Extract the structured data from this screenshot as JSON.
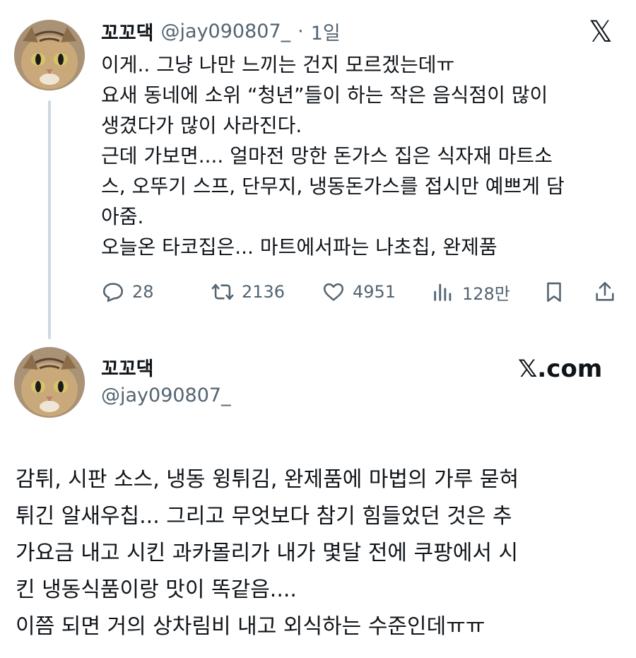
{
  "tweet1": {
    "display_name": "꼬꼬댁",
    "handle": "@jay090807_",
    "separator": "·",
    "time": "1일",
    "x_logo": "𝕏",
    "lines": [
      "이게.. 그냥 나만 느끼는 건지 모르겠는데ㅠ",
      "요새 동네에 소위 “청년”들이 하는 작은 음식점이 많이",
      "생겼다가 많이 사라진다.",
      "근데 가보면.... 얼마전 망한 돈가스 집은 식자재 마트소",
      "스, 오뚜기 스프, 단무지, 냉동돈가스를 접시만 예쁘게 담",
      "아줌.",
      "오늘온 타코집은... 마트에서파는 나초칩, 완제품"
    ],
    "actions": {
      "replies": "28",
      "retweets": "2136",
      "likes": "4951",
      "views": "128만"
    }
  },
  "tweet2": {
    "display_name": "꼬꼬댁",
    "handle": "@jay090807_",
    "watermark": "𝕏.com",
    "lines": [
      "감튀, 시판 소스, 냉동 윙튀김, 완제품에 마법의 가루 묻혀",
      "튀긴 알새우칩... 그리고 무엇보다 참기 힘들었던 것은 추",
      "가요금 내고 시킨 과카몰리가 내가 몇달 전에 쿠팡에서 시",
      "킨 냉동식품이랑 맛이 똑같음....",
      "이쯤 되면 거의 상차림비 내고 외식하는 수준인데ㅠㅠ"
    ]
  },
  "colors": {
    "text": "#0f1419",
    "secondary": "#536471",
    "thread_line": "#cfd9de"
  },
  "icons": [
    "reply-icon",
    "retweet-icon",
    "like-icon",
    "views-icon",
    "bookmark-icon",
    "share-icon",
    "x-logo-icon"
  ]
}
